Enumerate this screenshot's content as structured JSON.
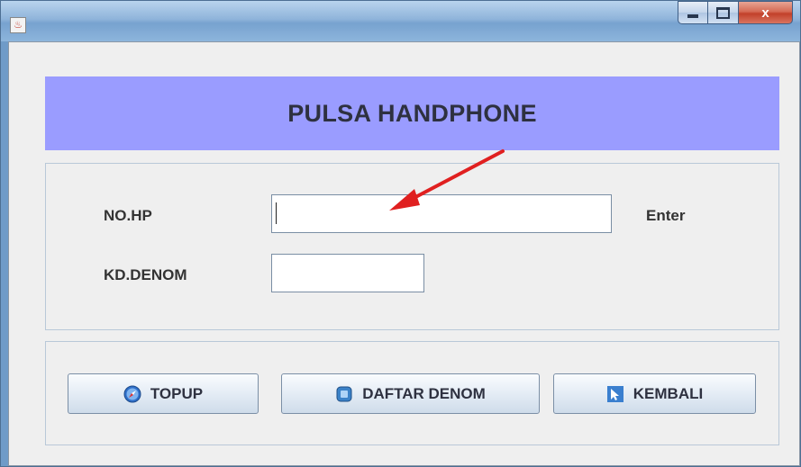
{
  "window": {
    "title": "",
    "close_glyph": "x"
  },
  "header": {
    "title": "PULSA HANDPHONE"
  },
  "form": {
    "nohp_label": "NO.HP",
    "nohp_value": "",
    "enter_label": "Enter",
    "kddenom_label": "KD.DENOM",
    "kddenom_value": ""
  },
  "buttons": {
    "topup": "TOPUP",
    "daftar_denom": "DAFTAR DENOM",
    "kembali": "KEMBALI"
  },
  "icons": {
    "app": "java-cup-icon",
    "topup": "safari-compass-icon",
    "daftar_denom": "list-icon",
    "kembali": "back-arrow-icon"
  },
  "colors": {
    "header_bg": "#9a9cff",
    "annotation_arrow": "#e02020"
  }
}
